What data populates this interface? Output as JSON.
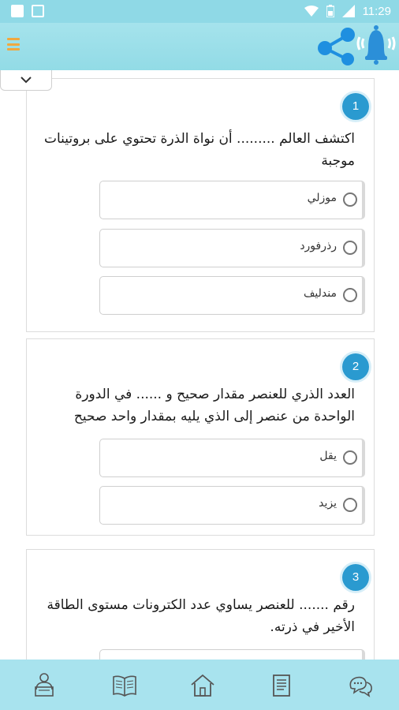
{
  "status_bar": {
    "time": "11:29",
    "left_icons": [
      "image-icon",
      "square-icon"
    ],
    "right_icons": [
      "wifi-icon",
      "battery-icon",
      "signal-icon"
    ]
  },
  "app_bar": {
    "icons": [
      "hamburger-menu-icon",
      "share-icon",
      "bell-icon"
    ],
    "accent_color": "#f0a840"
  },
  "collapse_tab": {
    "icon": "chevron-down-icon"
  },
  "questions": [
    {
      "number": "1",
      "text": "اكتشف العالم ......... أن نواة الذرة تحتوي على بروتينات موجبة",
      "options": [
        "موزلي",
        "رذرفورد",
        "مندليف"
      ]
    },
    {
      "number": "2",
      "text": "العدد الذري للعنصر مقدار صحيح و ...... في الدورة الواحدة من عنصر إلى الذي يليه بمقدار واحد صحيح",
      "options": [
        "يقل",
        "يزيد"
      ]
    },
    {
      "number": "3",
      "text": "رقم ....... للعنصر يساوي عدد الكترونات مستوى الطاقة الأخير في ذرته."
    }
  ],
  "bottom_nav": {
    "items": [
      "teacher-icon",
      "book-icon",
      "home-icon",
      "notes-icon",
      "chat-icon"
    ]
  },
  "colors": {
    "primary_bar": "#92dbe6",
    "question_badge": "#2a9ad0",
    "bell": "#2b8fd8"
  }
}
